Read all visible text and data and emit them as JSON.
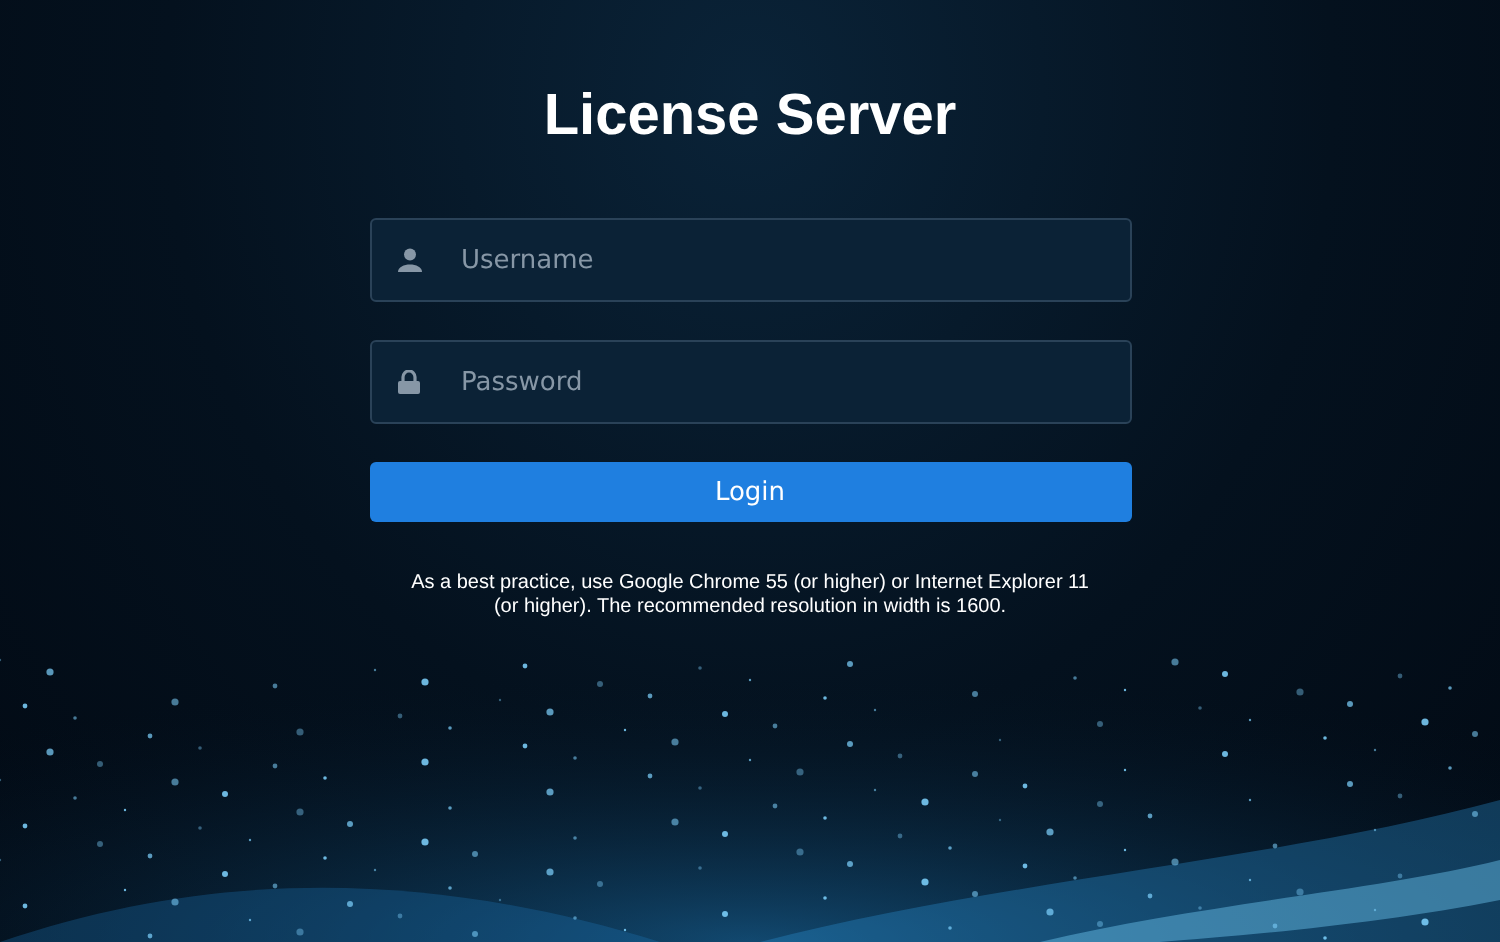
{
  "title": "License Server",
  "fields": [
    {
      "kind": "user",
      "placeholder": "Username"
    },
    {
      "kind": "password",
      "placeholder": "Password"
    }
  ],
  "login_button": "Login",
  "note": "As a best practice, use Google Chrome 55 (or higher) or Internet Explorer 11 (or higher). The recommended resolution in width is 1600."
}
